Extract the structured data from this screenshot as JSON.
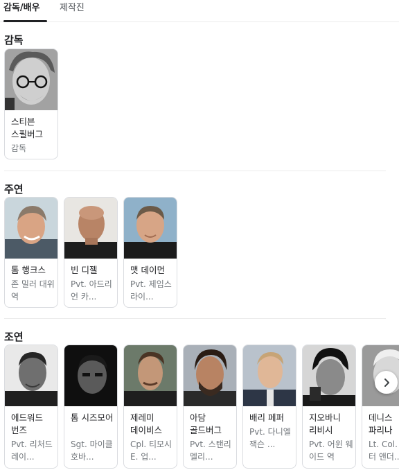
{
  "tabs": {
    "cast_crew": "감독/배우",
    "production": "제작진"
  },
  "sections": {
    "director": {
      "title": "감독",
      "people": [
        {
          "name": "스티븐 스필버그",
          "role": "감독"
        }
      ]
    },
    "lead": {
      "title": "주연",
      "people": [
        {
          "name": "톰 행크스",
          "role": "존 밀러 대위 역"
        },
        {
          "name": "빈 디젤",
          "role": "Pvt. 아드리언 카..."
        },
        {
          "name": "맷 데이먼",
          "role": "Pvt. 제임스 라이..."
        }
      ]
    },
    "supporting": {
      "title": "조연",
      "people": [
        {
          "name": "에드워드 번즈",
          "role": "Pvt. 리처드 레이..."
        },
        {
          "name": "톰 시즈모어",
          "role": "Sgt. 마이클 호바..."
        },
        {
          "name": "제레미 데이비스",
          "role": "Cpl. 티모시 E. 업..."
        },
        {
          "name": "아담 골드버그",
          "role": "Pvt. 스탠리 멜리..."
        },
        {
          "name": "배리 페퍼",
          "role": "Pvt. 다니엘 잭슨 ..."
        },
        {
          "name": "지오바니 리비시",
          "role": "Pvt. 어윈 웨이드 역"
        },
        {
          "name": "데니스 파리나",
          "role": "Lt. Col. 월터 앤더..."
        }
      ]
    }
  },
  "icons": {
    "next": "chevron-right-icon"
  }
}
